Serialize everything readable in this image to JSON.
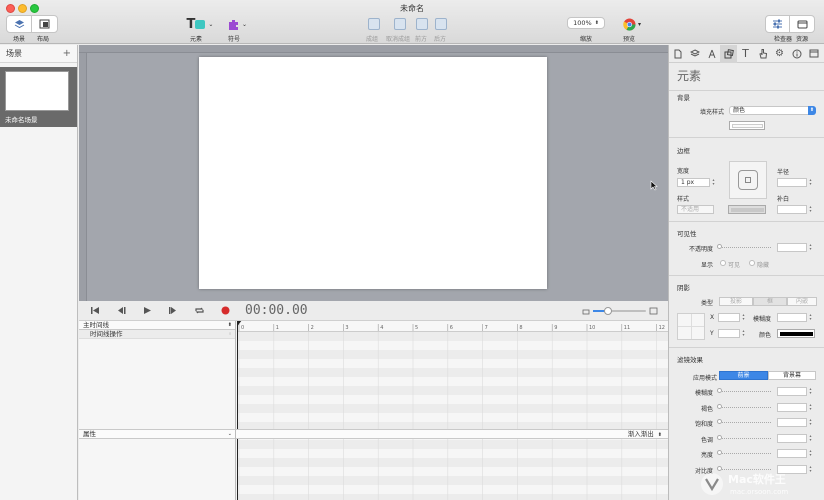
{
  "window": {
    "title": "未命名"
  },
  "toolbar": {
    "scene_label": "场景",
    "layout_label": "布局",
    "elements_label": "元素",
    "symbols_label": "符号",
    "group_label": "成组",
    "ungroup_label": "取消成组",
    "forward_label": "前方",
    "backward_label": "后方",
    "zoom_value": "100%",
    "zoom_label": "缩放",
    "preview_label": "预览",
    "inspector_label": "检查器",
    "resources_label": "资源"
  },
  "scenes": {
    "header": "场景",
    "add_symbol": "+",
    "items": [
      {
        "name": "未命名场景"
      }
    ]
  },
  "timeline": {
    "time": "00:00.00",
    "main_timeline": "主时间线",
    "action_row": "时间线操作",
    "properties": "属性",
    "easing": "渐入渐出",
    "ruler_marks": [
      "0",
      "1",
      "2",
      "3",
      "4",
      "5",
      "6",
      "7",
      "8",
      "9",
      "10",
      "11",
      "12"
    ]
  },
  "inspector": {
    "title": "元素",
    "background": {
      "section": "背景",
      "fill_style_label": "填充样式",
      "fill_style_value": "颜色"
    },
    "border": {
      "section": "边框",
      "width_label": "宽度",
      "width_value": "1 px",
      "radius_label": "半径",
      "style_label": "样式",
      "style_value": "不适用",
      "padding_label": "补白"
    },
    "visibility": {
      "section": "可见性",
      "opacity_label": "不透明度",
      "display_label": "显示",
      "visible_label": "可见",
      "hidden_label": "隐藏"
    },
    "shadow": {
      "section": "阴影",
      "type_label": "类型",
      "type_options": [
        "投影",
        "框",
        "内嵌"
      ],
      "x_label": "X",
      "y_label": "Y",
      "blur_label": "模糊度",
      "color_label": "颜色"
    },
    "filters": {
      "section": "滤镜效果",
      "apply_mode_label": "应用模式",
      "front_label": "前景",
      "backdrop_label": "背景幕",
      "items": [
        "模糊度",
        "褐色",
        "饱和度",
        "色调",
        "亮度",
        "对比度"
      ]
    }
  },
  "watermark": {
    "line1": "Mac软件王",
    "line2": "mac.orsoon.com"
  },
  "colors": {
    "accent": "#3d87e6",
    "record": "#d62b2b",
    "stage_bg": "#a3a6ad",
    "scene_selected": "#6a6a6a"
  }
}
